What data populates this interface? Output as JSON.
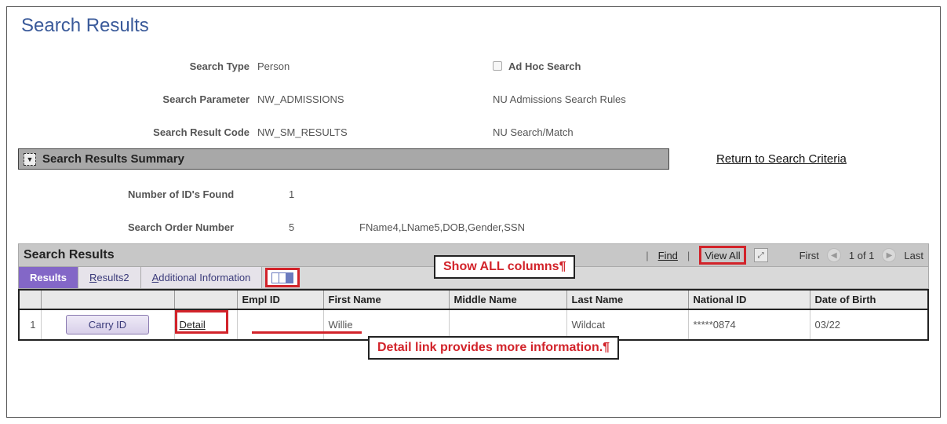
{
  "page_title": "Search Results",
  "info": {
    "search_type_label": "Search Type",
    "search_type_value": "Person",
    "adhoc_label": "Ad Hoc Search",
    "search_parameter_label": "Search Parameter",
    "search_parameter_value": "NW_ADMISSIONS",
    "search_parameter_desc": "NU Admissions Search Rules",
    "search_result_code_label": "Search Result Code",
    "search_result_code_value": "NW_SM_RESULTS",
    "search_result_code_desc": "NU Search/Match"
  },
  "summary": {
    "section_title": "Search Results Summary",
    "return_link": "Return to Search Criteria",
    "ids_found_label": "Number of ID's Found",
    "ids_found_value": "1",
    "order_number_label": "Search Order Number",
    "order_number_value": "5",
    "order_desc": "FName4,LName5,DOB,Gender,SSN"
  },
  "grid": {
    "title": "Search Results",
    "find_label": "Find",
    "view_all_label": "View All",
    "first_label": "First",
    "last_label": "Last",
    "counter": "1 of 1",
    "tabs": {
      "results": "Results",
      "results2_prefix": "R",
      "results2_rest": "esults2",
      "addl_prefix": "A",
      "addl_rest": "dditional Information"
    },
    "callouts": {
      "show_all": "Show ALL columns",
      "detail": "Detail link provides more information."
    },
    "columns": {
      "empl_id": "Empl ID",
      "first_name": "First Name",
      "middle_name": "Middle Name",
      "last_name": "Last Name",
      "national_id": "National ID",
      "dob": "Date of Birth"
    },
    "row": {
      "num": "1",
      "carry_id": "Carry ID",
      "detail": "Detail",
      "empl_id": "",
      "first_name": "Willie",
      "middle_name": "",
      "last_name": "Wildcat",
      "national_id": "*****0874",
      "dob": "03/22"
    }
  }
}
